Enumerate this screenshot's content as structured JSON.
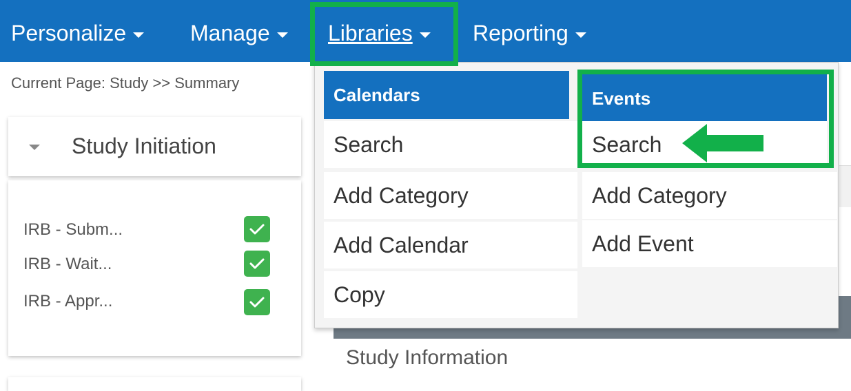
{
  "nav": {
    "items": [
      {
        "label": "Personalize"
      },
      {
        "label": "Manage"
      },
      {
        "label": "Libraries"
      },
      {
        "label": "Reporting"
      }
    ]
  },
  "breadcrumb": "Current Page: Study >> Summary",
  "study_initiation": {
    "title": "Study Initiation",
    "tasks": [
      {
        "label": "IRB - Subm...",
        "checked": true
      },
      {
        "label": "IRB - Wait...",
        "checked": true
      },
      {
        "label": "IRB - Appr...",
        "checked": true
      }
    ]
  },
  "dropdown": {
    "calendars": {
      "header": "Calendars",
      "items": [
        "Search",
        "Add Category",
        "Add Calendar",
        "Copy"
      ]
    },
    "events": {
      "header": "Events",
      "items": [
        "Search",
        "Add Category",
        "Add Event"
      ]
    }
  },
  "section_label": "Study Information",
  "colors": {
    "nav_bg": "#1470bf",
    "highlight": "#12b04a",
    "check": "#3fb24f"
  }
}
